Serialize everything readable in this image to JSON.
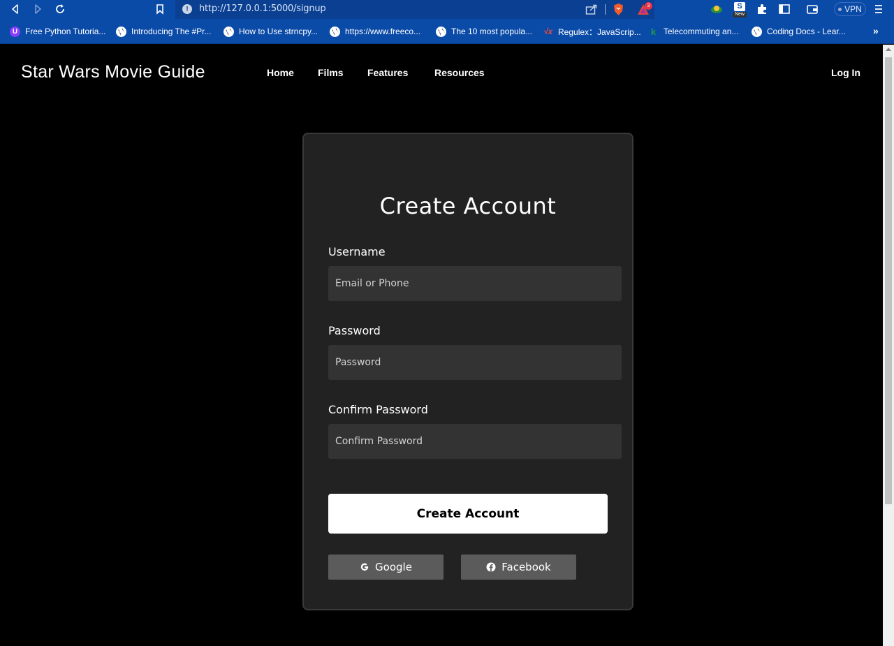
{
  "browser": {
    "url": "http://127.0.0.1:5000/signup",
    "vpn_label": "VPN",
    "rewards_count": "3",
    "new_badge": "New",
    "bookmarks": [
      {
        "label": "Free Python Tutoria...",
        "icon": "u-icon"
      },
      {
        "label": "Introducing The #Pr...",
        "icon": "globe-icon"
      },
      {
        "label": "How to Use strncpy...",
        "icon": "globe-icon"
      },
      {
        "label": "https://www.freeco...",
        "icon": "globe-icon"
      },
      {
        "label": "The 10 most popula...",
        "icon": "globe-icon"
      },
      {
        "label": "Regulex：JavaScrip...",
        "icon": "regex-icon"
      },
      {
        "label": "Telecommuting an...",
        "icon": "telecommuting-icon"
      },
      {
        "label": "Coding Docs - Lear...",
        "icon": "globe-icon"
      }
    ],
    "more_bookmarks": "»"
  },
  "site": {
    "title": "Star Wars Movie Guide",
    "nav": [
      "Home",
      "Films",
      "Features",
      "Resources"
    ],
    "login": "Log In"
  },
  "form": {
    "title": "Create Account",
    "username_label": "Username",
    "username_placeholder": "Email or Phone",
    "password_label": "Password",
    "password_placeholder": "Password",
    "confirm_label": "Confirm Password",
    "confirm_placeholder": "Confirm Password",
    "submit_label": "Create Account",
    "google_label": "Google",
    "facebook_label": "Facebook"
  }
}
